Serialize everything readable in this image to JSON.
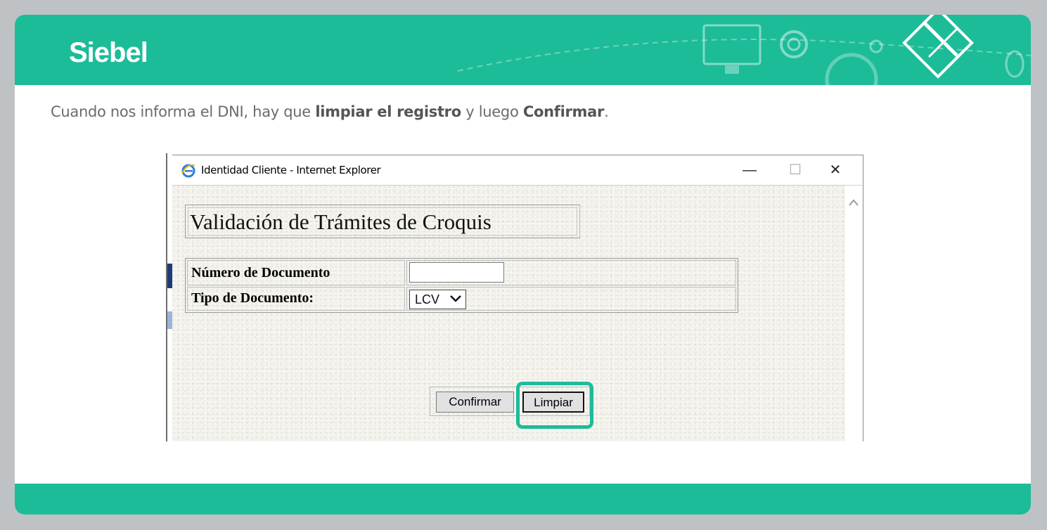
{
  "slide": {
    "brand": "Siebel",
    "intro_pre": "Cuando nos informa el DNI, hay que ",
    "intro_bold1": "limpiar el registro",
    "intro_mid": " y luego ",
    "intro_bold2": "Confirmar",
    "intro_post": "."
  },
  "window": {
    "title": "Identidad Cliente - Internet Explorer",
    "controls": {
      "minimize": "—",
      "maximize": "☐",
      "close": "✕"
    }
  },
  "form": {
    "heading": "Validación de Trámites de Croquis",
    "doc_number_label": "Número de Documento",
    "doc_number_value": "",
    "doc_type_label": "Tipo de Documento:",
    "doc_type_selected": "LCV",
    "confirm_label": "Confirmar",
    "clear_label": "Limpiar"
  },
  "colors": {
    "accent": "#1dbc99",
    "background": "#bfc2c4"
  },
  "icons": [
    "internet-explorer-icon",
    "chevron-down-icon",
    "scroll-up-icon"
  ]
}
